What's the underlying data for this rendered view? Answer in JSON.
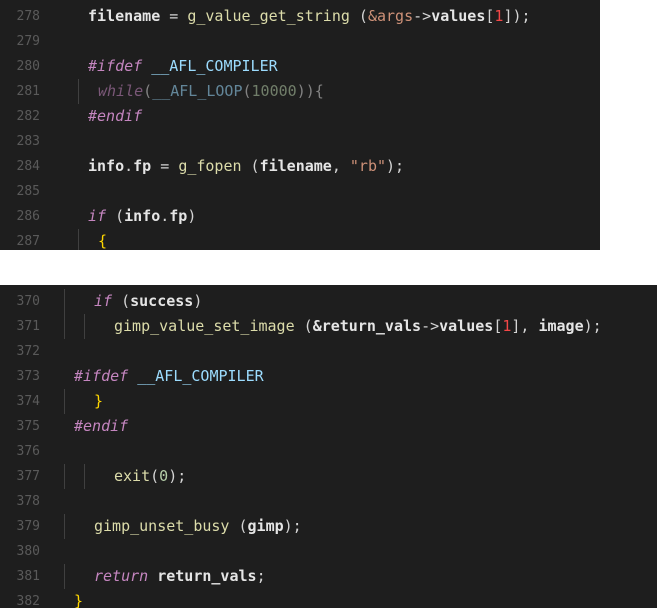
{
  "top_snippet": {
    "lines": [
      {
        "num": "278",
        "indent": 0,
        "tokens": [
          {
            "t": "filename",
            "c": "t-key"
          },
          {
            "t": " = ",
            "c": "t-plain"
          },
          {
            "t": "g_value_get_string",
            "c": "t-fn"
          },
          {
            "t": " (",
            "c": "t-plain"
          },
          {
            "t": "&args",
            "c": "t-str"
          },
          {
            "t": "->",
            "c": "t-plain"
          },
          {
            "t": "values",
            "c": "t-key"
          },
          {
            "t": "[",
            "c": "t-plain"
          },
          {
            "t": "1",
            "c": "t-idx"
          },
          {
            "t": "]);",
            "c": "t-plain"
          }
        ]
      },
      {
        "num": "279",
        "indent": 0,
        "tokens": []
      },
      {
        "num": "280",
        "indent": 0,
        "tokens": [
          {
            "t": "#ifdef",
            "c": "t-pre"
          },
          {
            "t": " __AFL_COMPILER",
            "c": "t-macro"
          }
        ]
      },
      {
        "num": "281",
        "indent": 1,
        "dim": true,
        "tokens": [
          {
            "t": "while",
            "c": "t-ctl"
          },
          {
            "t": "(",
            "c": "t-plain"
          },
          {
            "t": "__AFL_LOOP",
            "c": "t-macro"
          },
          {
            "t": "(",
            "c": "t-plain"
          },
          {
            "t": "10000",
            "c": "t-num"
          },
          {
            "t": ")){",
            "c": "t-plain"
          }
        ]
      },
      {
        "num": "282",
        "indent": 0,
        "tokens": [
          {
            "t": "#endif",
            "c": "t-pre"
          }
        ]
      },
      {
        "num": "283",
        "indent": 0,
        "tokens": []
      },
      {
        "num": "284",
        "indent": 0,
        "tokens": [
          {
            "t": "info",
            "c": "t-key"
          },
          {
            "t": ".",
            "c": "t-plain"
          },
          {
            "t": "fp",
            "c": "t-key"
          },
          {
            "t": " = ",
            "c": "t-plain"
          },
          {
            "t": "g_fopen",
            "c": "t-fn"
          },
          {
            "t": " (",
            "c": "t-plain"
          },
          {
            "t": "filename",
            "c": "t-key"
          },
          {
            "t": ", ",
            "c": "t-plain"
          },
          {
            "t": "\"rb\"",
            "c": "t-str"
          },
          {
            "t": ");",
            "c": "t-plain"
          }
        ]
      },
      {
        "num": "285",
        "indent": 0,
        "tokens": []
      },
      {
        "num": "286",
        "indent": 0,
        "tokens": [
          {
            "t": "if",
            "c": "t-ctl"
          },
          {
            "t": " (",
            "c": "t-plain"
          },
          {
            "t": "info",
            "c": "t-key"
          },
          {
            "t": ".",
            "c": "t-plain"
          },
          {
            "t": "fp",
            "c": "t-key"
          },
          {
            "t": ")",
            "c": "t-plain"
          }
        ]
      },
      {
        "num": "287",
        "indent": 1,
        "tokens": [
          {
            "t": "{",
            "c": "t-brace"
          }
        ]
      }
    ]
  },
  "bottom_snippet": {
    "lines": [
      {
        "num": "370",
        "indent": 1,
        "tokens": [
          {
            "t": "if",
            "c": "t-ctl"
          },
          {
            "t": " (",
            "c": "t-plain"
          },
          {
            "t": "success",
            "c": "t-key"
          },
          {
            "t": ")",
            "c": "t-plain"
          }
        ]
      },
      {
        "num": "371",
        "indent": 2,
        "tokens": [
          {
            "t": "gimp_value_set_image",
            "c": "t-fn"
          },
          {
            "t": " (",
            "c": "t-plain"
          },
          {
            "t": "&return_vals",
            "c": "t-key"
          },
          {
            "t": "->",
            "c": "t-plain"
          },
          {
            "t": "values",
            "c": "t-key"
          },
          {
            "t": "[",
            "c": "t-plain"
          },
          {
            "t": "1",
            "c": "t-idx"
          },
          {
            "t": "], ",
            "c": "t-plain"
          },
          {
            "t": "image",
            "c": "t-key"
          },
          {
            "t": ");",
            "c": "t-plain"
          }
        ]
      },
      {
        "num": "372",
        "indent": 0,
        "tokens": []
      },
      {
        "num": "373",
        "indent": 0,
        "tokens": [
          {
            "t": "#ifdef",
            "c": "t-pre"
          },
          {
            "t": " __AFL_COMPILER",
            "c": "t-macro"
          }
        ]
      },
      {
        "num": "374",
        "indent": 1,
        "tokens": [
          {
            "t": "}",
            "c": "t-brace"
          }
        ]
      },
      {
        "num": "375",
        "indent": 0,
        "tokens": [
          {
            "t": "#endif",
            "c": "t-pre"
          }
        ]
      },
      {
        "num": "376",
        "indent": 0,
        "tokens": []
      },
      {
        "num": "377",
        "indent": 2,
        "tokens": [
          {
            "t": "exit",
            "c": "t-fn"
          },
          {
            "t": "(",
            "c": "t-plain"
          },
          {
            "t": "0",
            "c": "t-num"
          },
          {
            "t": ");",
            "c": "t-plain"
          }
        ]
      },
      {
        "num": "378",
        "indent": 0,
        "tokens": []
      },
      {
        "num": "379",
        "indent": 1,
        "tokens": [
          {
            "t": "gimp_unset_busy",
            "c": "t-fn"
          },
          {
            "t": " (",
            "c": "t-plain"
          },
          {
            "t": "gimp",
            "c": "t-key"
          },
          {
            "t": ");",
            "c": "t-plain"
          }
        ]
      },
      {
        "num": "380",
        "indent": 0,
        "tokens": []
      },
      {
        "num": "381",
        "indent": 1,
        "tokens": [
          {
            "t": "return",
            "c": "t-ctl"
          },
          {
            "t": " ",
            "c": "t-plain"
          },
          {
            "t": "return_vals",
            "c": "t-key"
          },
          {
            "t": ";",
            "c": "t-plain"
          }
        ]
      },
      {
        "num": "382",
        "indent": 0,
        "tokens": [
          {
            "t": "}",
            "c": "t-brace"
          }
        ]
      }
    ]
  },
  "colors": {
    "editor_background": "#1e1e1e",
    "gap_background": "#ffffff",
    "line_number": "#5a5a5a",
    "keyword": "#c586c0",
    "function": "#dcdcaa",
    "string": "#ce9178",
    "number": "#b5cea8",
    "brace": "#ffd700"
  }
}
